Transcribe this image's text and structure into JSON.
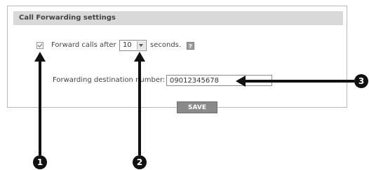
{
  "panel": {
    "title": "Call Forwarding settings"
  },
  "forward_row": {
    "checked": true,
    "label_before": "Forward calls after",
    "selected_seconds": "10",
    "label_after": "seconds.",
    "help_icon": "question-mark-icon"
  },
  "destination": {
    "label": "Forwarding destination number:",
    "value": "09012345678"
  },
  "save_label": "SAVE",
  "callouts": [
    "1",
    "2",
    "3"
  ]
}
